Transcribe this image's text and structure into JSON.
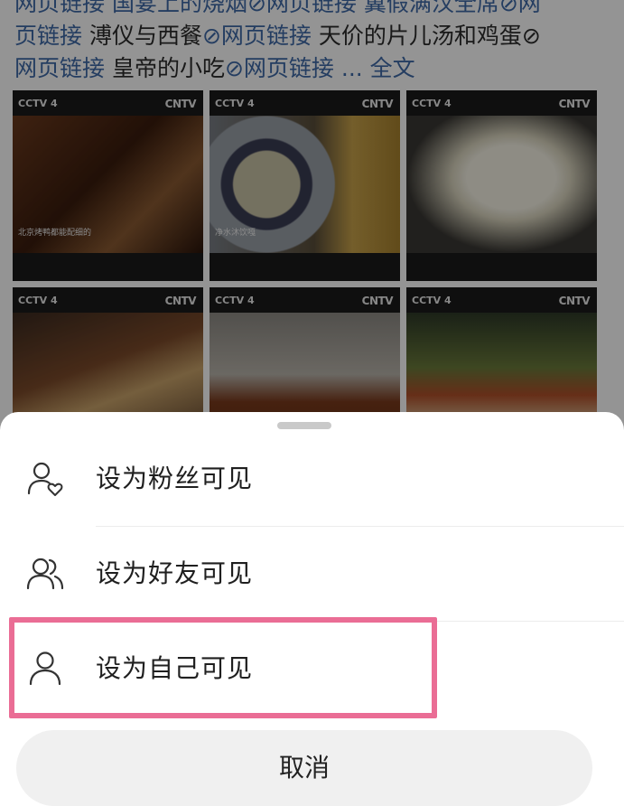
{
  "post": {
    "line1": "网页链接   国宴上的烧烟⊘网页链接   翼假满汉全席⊘网",
    "line2_prefix": "页链接",
    "line2_mid": "   溥仪与西餐",
    "line2_link": "⊘网页链接",
    "line2_suffix": "   天价的片儿汤和鸡蛋⊘",
    "line3_link": "网页链接",
    "line3_mid": "   皇帝的小吃",
    "line3_link2": "⊘网页链接",
    "line3_more": "   ...  全文"
  },
  "tiles": [
    {
      "logo": "CNTV",
      "channel": "CCTV 4",
      "caption": "北京烤鸭都能配细的"
    },
    {
      "logo": "CNTV",
      "channel": "CCTV 4",
      "caption": "净水沐饮嘎"
    },
    {
      "logo": "CNTV",
      "channel": "CCTV 4",
      "caption": ""
    },
    {
      "logo": "CNTV",
      "channel": "CCTV 4",
      "caption": ""
    },
    {
      "logo": "CNTV",
      "channel": "CCTV 4",
      "caption": ""
    },
    {
      "logo": "CNTV",
      "channel": "CCTV 4",
      "caption": ""
    }
  ],
  "sheet": {
    "options": [
      {
        "label": "设为粉丝可见",
        "icon": "user-heart-icon"
      },
      {
        "label": "设为好友可见",
        "icon": "users-icon"
      },
      {
        "label": "设为自己可见",
        "icon": "user-icon"
      }
    ],
    "cancel_label": "取消",
    "highlight_color": "#ea6d95"
  }
}
